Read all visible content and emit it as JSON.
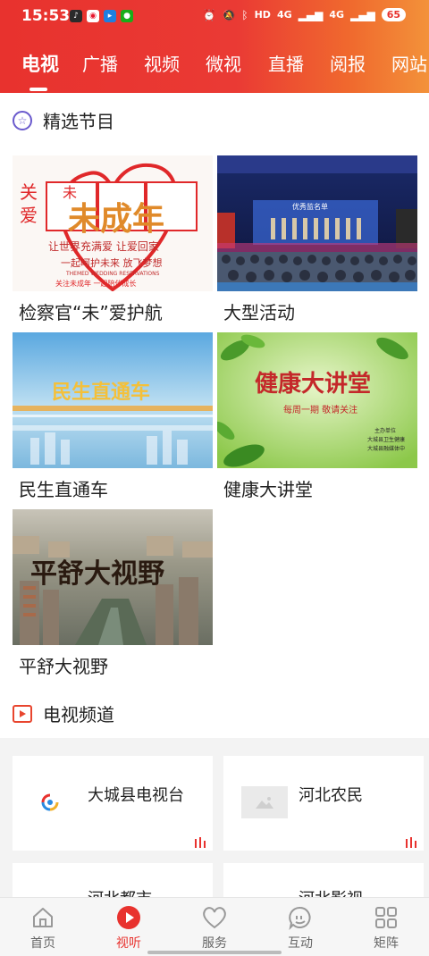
{
  "status": {
    "time": "15:53",
    "network_labels": [
      "HD",
      "4G",
      "4G"
    ],
    "battery": "65",
    "notif_icons": [
      "douyin-icon",
      "weibo-icon",
      "app-icon",
      "wechat-icon"
    ]
  },
  "colors": {
    "accent": "#e8322e",
    "header_gradient_end": "#f3923a"
  },
  "tabs": [
    "电视",
    "广播",
    "视频",
    "微视",
    "直播",
    "阅报",
    "网站"
  ],
  "active_tab": "电视",
  "featured": {
    "title": "精选节目",
    "programs": [
      {
        "title": "检察官“未”爱护航"
      },
      {
        "title": "大型活动"
      },
      {
        "title": "民生直通车"
      },
      {
        "title": "健康大讲堂"
      },
      {
        "title": "平舒大视野"
      }
    ]
  },
  "thumbnail_text": {
    "wei": {
      "heading": "未成年",
      "side_a": "关",
      "side_b": "爱",
      "line1": "让世界充满爱  让爱回家",
      "line2": "一起呵护未来  放飞梦想",
      "line3": "THEMED WEDDING RESERVATIONS",
      "line4": "关注未成年 一起陪伴成长"
    },
    "event": {
      "banner": "优秀监名单"
    },
    "minsheng": {
      "title": "民生直通车"
    },
    "health": {
      "title": "健康大讲堂",
      "subtitle": "每周一期  敬请关注",
      "org1": "主办单位",
      "org2": "大城县卫生健康",
      "org3": "大城县融媒体中"
    },
    "pingshu": {
      "title": "平舒大视野"
    }
  },
  "channels": {
    "title": "电视频道",
    "items": [
      {
        "name": "大城县电视台"
      },
      {
        "name": "河北农民"
      },
      {
        "name": "河北都市"
      },
      {
        "name": "河北影视"
      }
    ]
  },
  "bottom_nav": [
    {
      "label": "首页",
      "icon": "home-icon"
    },
    {
      "label": "视听",
      "icon": "play-icon"
    },
    {
      "label": "服务",
      "icon": "heart-icon"
    },
    {
      "label": "互动",
      "icon": "chat-icon"
    },
    {
      "label": "矩阵",
      "icon": "grid-icon"
    }
  ],
  "active_nav": "视听"
}
